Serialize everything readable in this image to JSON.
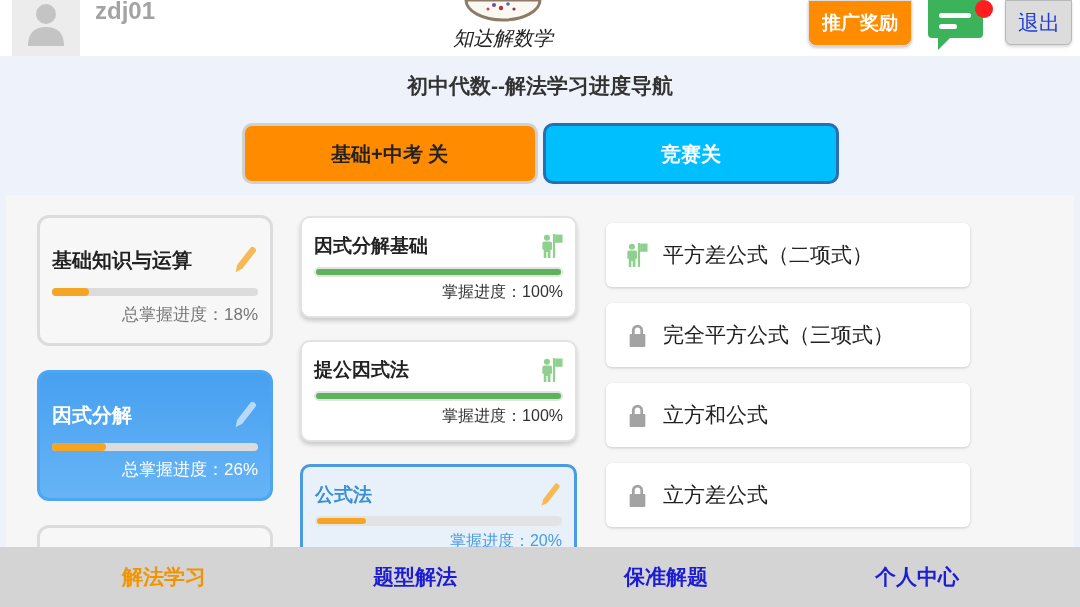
{
  "header": {
    "username": "zdj01",
    "logo_text": "知达解数学",
    "promo_button": "推广奖励",
    "notification": {
      "unread": true
    },
    "logout_button": "退出"
  },
  "title": "初中代数--解法学习进度导航",
  "stage_tabs": [
    {
      "label": "基础+中考 关",
      "selected": true,
      "color": "#ff8c00"
    },
    {
      "label": "竞赛关",
      "selected": false,
      "color": "#00bfff"
    }
  ],
  "categories": [
    {
      "title": "基础知识与运算",
      "level": 0.18,
      "progress": "总掌握进度：18%",
      "selected": false
    },
    {
      "title": "因式分解",
      "level": 0.26,
      "progress": "总掌握进度：26%",
      "selected": true
    },
    {
      "selected": false
    }
  ],
  "topics": [
    {
      "title": "因式分解基础",
      "kind": "completed",
      "level": 1,
      "progress": "掌握进度：100%",
      "selected": false
    },
    {
      "title": "提公因式法",
      "kind": "completed",
      "level": 1,
      "progress": "掌握进度：100%",
      "selected": false
    },
    {
      "title": "公式法",
      "kind": "learning",
      "level": 0.2,
      "progress": "掌握进度：20%",
      "selected": true
    }
  ],
  "methods": [
    {
      "label": "平方差公式（二项式）",
      "locked": false
    },
    {
      "label": "完全平方公式（三项式）",
      "locked": true
    },
    {
      "label": "立方和公式",
      "locked": true
    },
    {
      "label": "立方差公式",
      "locked": true
    }
  ],
  "bottom_nav": [
    {
      "label": "解法学习",
      "selected": true
    },
    {
      "label": "题型解法",
      "selected": false
    },
    {
      "label": "保准解题",
      "selected": false
    },
    {
      "label": "个人中心",
      "selected": false
    }
  ]
}
